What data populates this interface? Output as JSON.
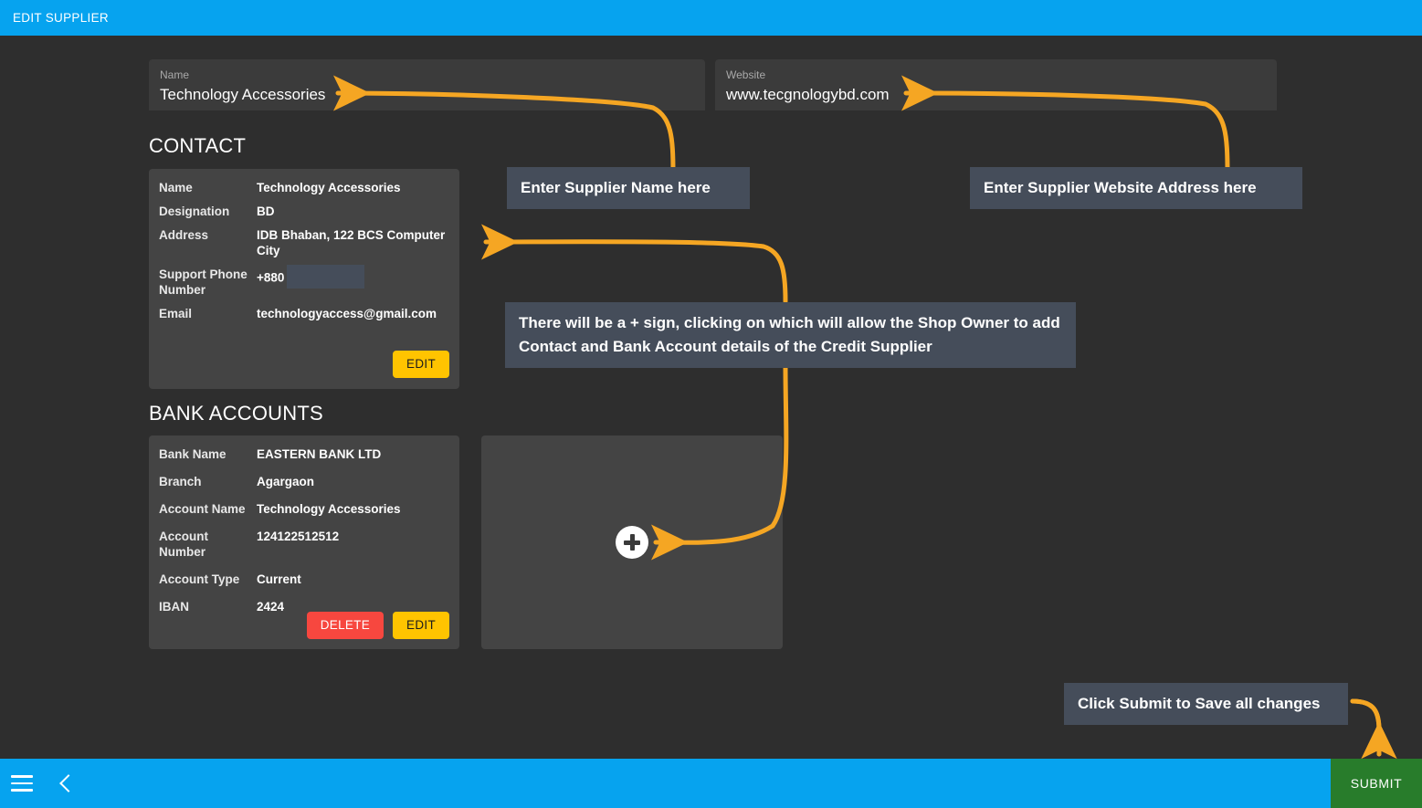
{
  "window": {
    "title": "EDIT SUPPLIER"
  },
  "form": {
    "name_field": {
      "label": "Name",
      "value": "Technology Accessories"
    },
    "website_field": {
      "label": "Website",
      "value": "www.tecgnologybd.com"
    }
  },
  "contact_section": {
    "heading": "CONTACT",
    "rows": [
      {
        "key": "Name",
        "value": "Technology Accessories"
      },
      {
        "key": "Designation",
        "value": "BD"
      },
      {
        "key": "Address",
        "value": "IDB Bhaban, 122 BCS Computer City"
      },
      {
        "key": "Support Phone Number",
        "value": "+880"
      },
      {
        "key": "Email",
        "value": "technologyaccess@gmail.com"
      }
    ],
    "edit_label": "EDIT"
  },
  "bank_section": {
    "heading": "BANK ACCOUNTS",
    "rows": [
      {
        "key": "Bank Name",
        "value": "EASTERN BANK LTD"
      },
      {
        "key": "Branch",
        "value": "Agargaon"
      },
      {
        "key": "Account Name",
        "value": "Technology Accessories"
      },
      {
        "key": "Account Number",
        "value": "124122512512"
      },
      {
        "key": "Account Type",
        "value": "Current"
      },
      {
        "key": "IBAN",
        "value": "2424"
      }
    ],
    "delete_label": "DELETE",
    "edit_label": "EDIT"
  },
  "add_card": {
    "icon": "plus-icon"
  },
  "annotations": [
    {
      "text": "Enter Supplier Name here"
    },
    {
      "text": "Enter Supplier Website Address here"
    },
    {
      "text": "There will be a + sign, clicking on which will allow the Shop Owner to add Contact and Bank Account details of the Credit Supplier"
    },
    {
      "text": "Click Submit to Save all changes"
    }
  ],
  "bottom_bar": {
    "menu_icon": "hamburger-menu-icon",
    "back_icon": "chevron-left-icon",
    "submit_label": "SUBMIT"
  },
  "colors": {
    "app_bar": "#06a3ef",
    "page_background": "#2e2e2e",
    "card_background": "#444444",
    "field_background": "#3b3b3b",
    "callout_background": "#454d5a",
    "accent_edit": "#ffc400",
    "accent_delete": "#f7473f",
    "submit_green": "#287c2b",
    "arrow_orange": "#f5a623"
  }
}
